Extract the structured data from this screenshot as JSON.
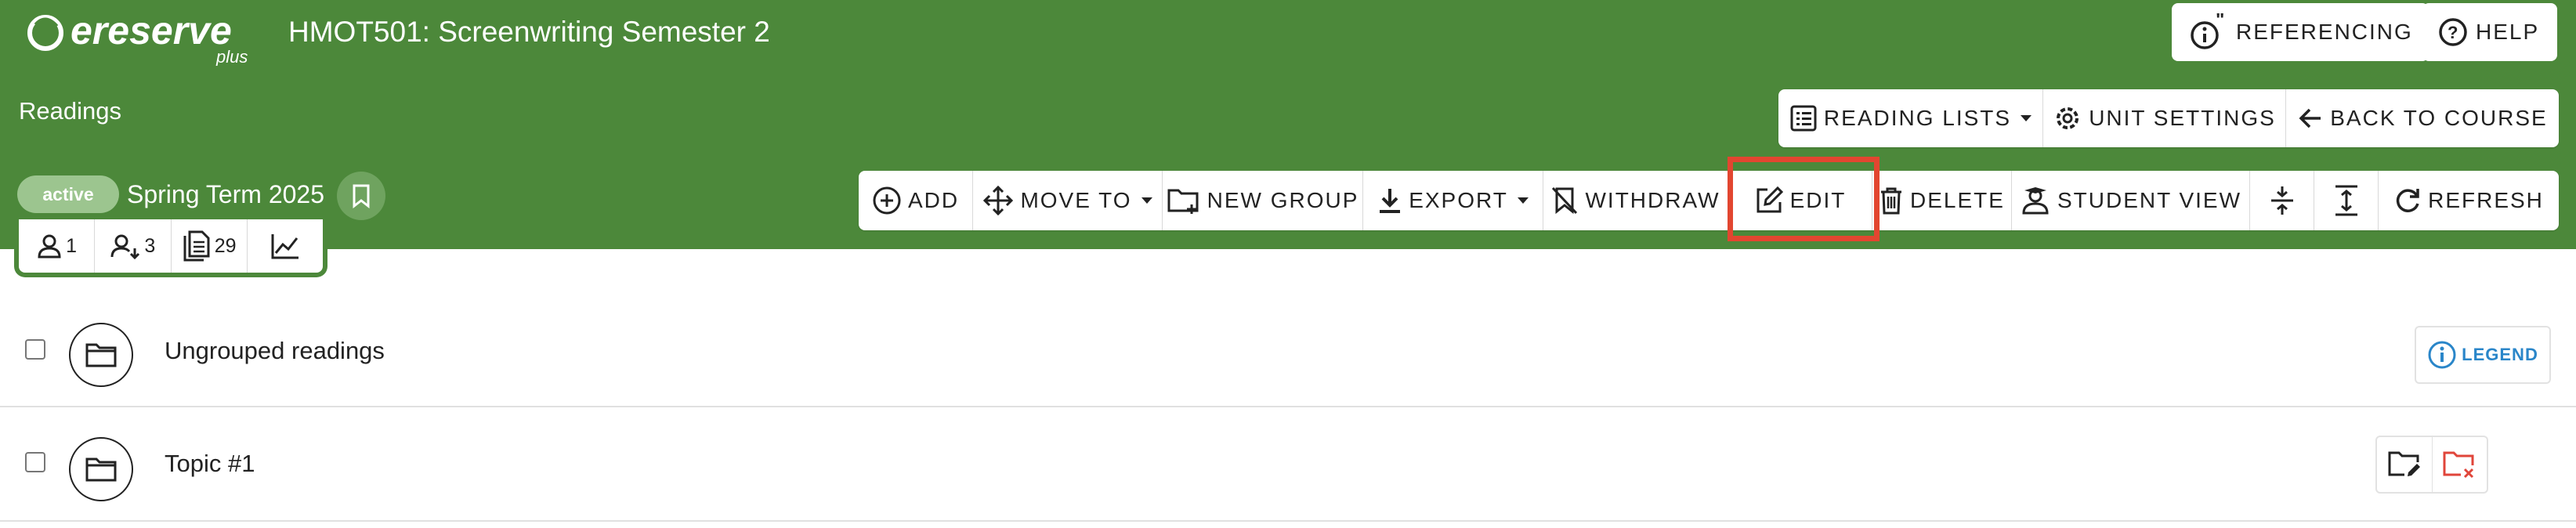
{
  "brand": {
    "name": "ereserve",
    "sub": "plus"
  },
  "header": {
    "unit_title": "HMOT501: Screenwriting Semester 2",
    "section": "Readings"
  },
  "top_right": {
    "referencing": "REFERENCING",
    "help": "HELP"
  },
  "nav_toolbar": {
    "reading_lists": "READING LISTS",
    "unit_settings": "UNIT SETTINGS",
    "back_to_course": "BACK TO COURSE"
  },
  "status": {
    "badge": "active",
    "term": "Spring Term 2025"
  },
  "stats": {
    "users": "1",
    "readers": "3",
    "readings": "29"
  },
  "actions": {
    "add": "ADD",
    "move_to": "MOVE TO",
    "new_group": "NEW GROUP",
    "export": "EXPORT",
    "withdraw": "WITHDRAW",
    "edit": "EDIT",
    "delete": "DELETE",
    "student_view": "STUDENT VIEW",
    "refresh": "REFRESH"
  },
  "groups": [
    {
      "title": "Ungrouped readings"
    },
    {
      "title": "Topic #1"
    }
  ],
  "legend": "LEGEND",
  "colors": {
    "header_green": "#4c883a",
    "highlight": "#e24630",
    "legend_blue": "#2a86c9",
    "delete_red": "#e0453a"
  }
}
